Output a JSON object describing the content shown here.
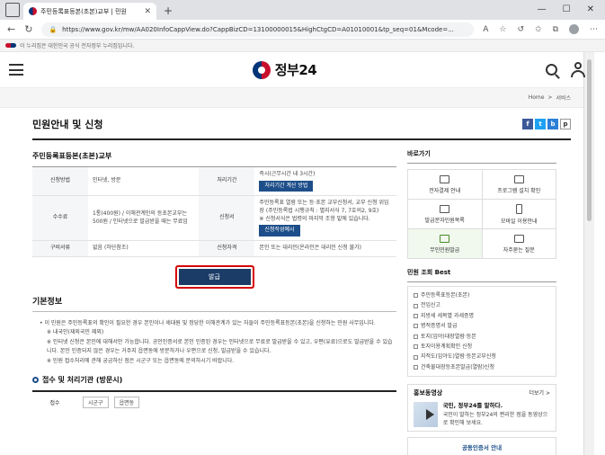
{
  "browser": {
    "tab_title": "주민등록표등본(초본)교부 | 민원",
    "url": "https://www.gov.kr/mw/AA020InfoCappView.do?CappBizCD=13100000015&HighCtgCD=A01010001&tp_seq=01&Mcode=..."
  },
  "gov_banner": "이 누리집은 대한민국 공식 전자정부 누리집입니다.",
  "site": {
    "logo_text": "정부24",
    "breadcrumb": {
      "home": "Home",
      "sep": ">",
      "current": "서비스"
    },
    "page_title": "민원안내 및 신청",
    "share": [
      "f",
      "t",
      "b",
      "p"
    ]
  },
  "service": {
    "title": "주민등록표등본(초본)교부",
    "rows": [
      {
        "h1": "신청방법",
        "v1": "인터넷, 방문",
        "h2": "처리기간",
        "v2": "즉시(근무시간 내 3시간)",
        "btn2": "처리기간 계산 방법"
      },
      {
        "h1": "수수료",
        "v1": "1통(400원) / 이해관계인의 등초본교부는 500원 / 인터넷으로 발급받을 때는 무료임",
        "h2": "신청서",
        "v2": "주민등록표 열람 또는 등·초본 교부신청서, 교부 신청 위임장 (주민등록법 시행규칙 : 별지서식 7, 7호의2, 9호)",
        "v2b": "※ 신청서식은 법령의 마지막 조항 밑에 있습니다.",
        "btn2": "신청작성예시"
      },
      {
        "h1": "구비서류",
        "v1": "없음 (하단참조)",
        "h2": "신청자격",
        "v2": "본인 또는 대리인(온라인은 대리인 신청 불가)"
      }
    ],
    "apply_label": "발급"
  },
  "basic_info": {
    "heading": "기본정보",
    "lines": [
      "이 민원은 주민등록표의 확인이 필요한 경우 본인이나 세대원 및 정당한 이해관계가 있는 자들이 주민등록표등본(초본)을 신청하는 민원 사무입니다.",
      "※ 내국인(재외국민 제외)",
      "※ 인터넷 신청은 본인에 대해서만 가능합니다. 공인인증서로 본인 인증된 경우는 인터넷으로 무료로 발급받을 수 있고, 우편(유료)으로도 발급받을 수 있습니다. 본인 인증되지 않은 경우는 거주지 읍면동에 방문하거나 우편으로 신청, 발급받을 수 있습니다.",
      "※ 민원 접수처리에 관해 궁금하신 점은 시군구 또는 읍면동에 문의하시기 바랍니다."
    ]
  },
  "office": {
    "heading": "접수 및 처리기관 (방문시)",
    "row_label": "접수",
    "chips": [
      "시군구",
      "읍면동"
    ]
  },
  "sidebar": {
    "shortcuts_title": "바로가기",
    "shortcuts": [
      "전자결제 안내",
      "프로그램 설치 확인",
      "발급문자민원목록",
      "모바일 이용안내",
      "무인민원발급",
      "자주묻는 질문"
    ],
    "best_title": "민원 조회 Best",
    "best": [
      "주민등록표등본(초본)",
      "전입신고",
      "지방세 세목별 과세증명",
      "병적증명서 발급",
      "토지(임야)대장열람·등본",
      "토지이용계획확인 신청",
      "지적도(임야도)열람·등본교부신청",
      "건축물대장등초본발급(열람)신청"
    ],
    "promo_title": "홍보동영상",
    "promo_more": "더보기 >",
    "promo_head": "국민, 정부24를 말하다.",
    "promo_body": "국민이 말하는 정부24의 편리한 점을 동영상으로 확인해 보세요.",
    "cert_label": "공동인증서 안내"
  }
}
